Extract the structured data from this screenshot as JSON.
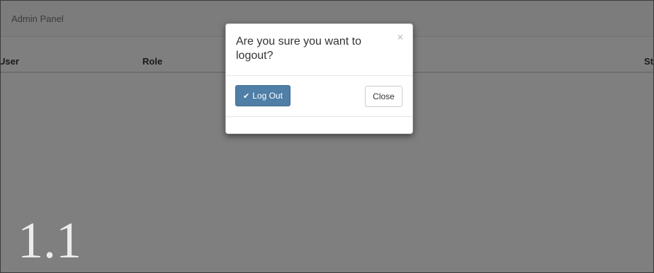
{
  "navbar": {
    "brand": "Admin Panel"
  },
  "table": {
    "headers": [
      "User",
      "Role",
      "St"
    ]
  },
  "version_label": "1.1",
  "modal": {
    "title": "Are you sure you want to logout?",
    "close_glyph": "×",
    "logout_label": "Log Out",
    "logout_icon": "check-icon",
    "close_label": "Close"
  }
}
